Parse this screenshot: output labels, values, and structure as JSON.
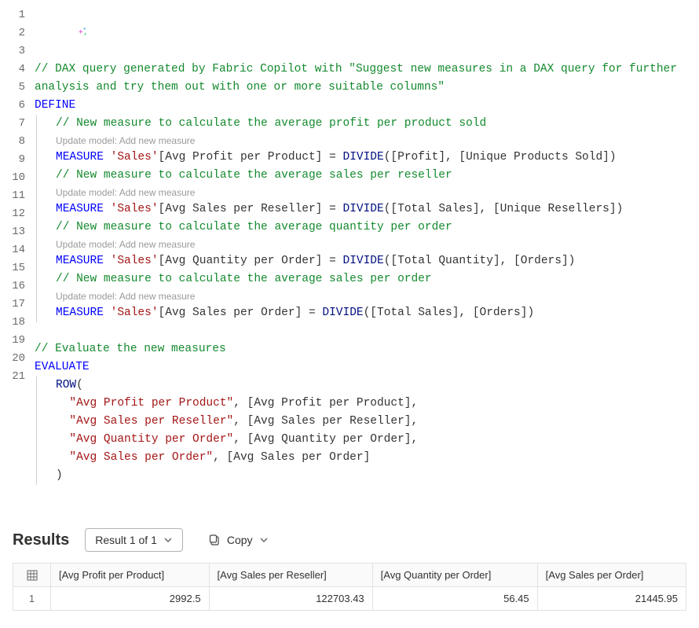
{
  "editor": {
    "line_numbers": [
      "1",
      "2",
      "",
      "3",
      "4",
      "",
      "5",
      "6",
      "",
      "7",
      "8",
      "",
      "9",
      "10",
      "",
      "11",
      "12",
      "13",
      "14",
      "15",
      "16",
      "17",
      "18",
      "19",
      "20",
      "21"
    ],
    "copilot_icon": "copilot-icon",
    "comment_intro_1": "// DAX query generated by Fabric Copilot with \"Suggest new measures in a DAX query for further",
    "comment_intro_2": "analysis and try them out with one or more suitable columns\"",
    "kw_define": "DEFINE",
    "hint_text": "Update model: Add new measure",
    "m1_comment": "// New measure to calculate the average profit per product sold",
    "m1_kw": "MEASURE ",
    "m1_table": "'Sales'",
    "m1_name": "[Avg Profit per Product]",
    "m1_eq": " = ",
    "m1_fn": "DIVIDE",
    "m1_args": "([Profit], [Unique Products Sold])",
    "m2_comment": "// New measure to calculate the average sales per reseller",
    "m2_name": "[Avg Sales per Reseller]",
    "m2_args": "([Total Sales], [Unique Resellers])",
    "m3_comment": "// New measure to calculate the average quantity per order",
    "m3_name": "[Avg Quantity per Order]",
    "m3_args": "([Total Quantity], [Orders])",
    "m4_comment": "// New measure to calculate the average sales per order",
    "m4_name": "[Avg Sales per Order]",
    "m4_args": "([Total Sales], [Orders])",
    "eval_comment": "// Evaluate the new measures",
    "kw_evaluate": "EVALUATE",
    "kw_row": "ROW",
    "paren_open": "(",
    "paren_close": ")",
    "row_s1": "\"Avg Profit per Product\"",
    "row_m1": "[Avg Profit per Product]",
    "row_s2": "\"Avg Sales per Reseller\"",
    "row_m2": "[Avg Sales per Reseller]",
    "row_s3": "\"Avg Quantity per Order\"",
    "row_m3": "[Avg Quantity per Order]",
    "row_s4": "\"Avg Sales per Order\"",
    "row_m4": "[Avg Sales per Order]",
    "comma": ","
  },
  "results": {
    "title": "Results",
    "result_selector": "Result 1 of 1",
    "copy_label": "Copy",
    "columns": [
      "[Avg Profit per Product]",
      "[Avg Sales per Reseller]",
      "[Avg Quantity per Order]",
      "[Avg Sales per Order]"
    ],
    "rows": [
      {
        "n": "1",
        "values": [
          "2992.5",
          "122703.43",
          "56.45",
          "21445.95"
        ]
      }
    ]
  }
}
